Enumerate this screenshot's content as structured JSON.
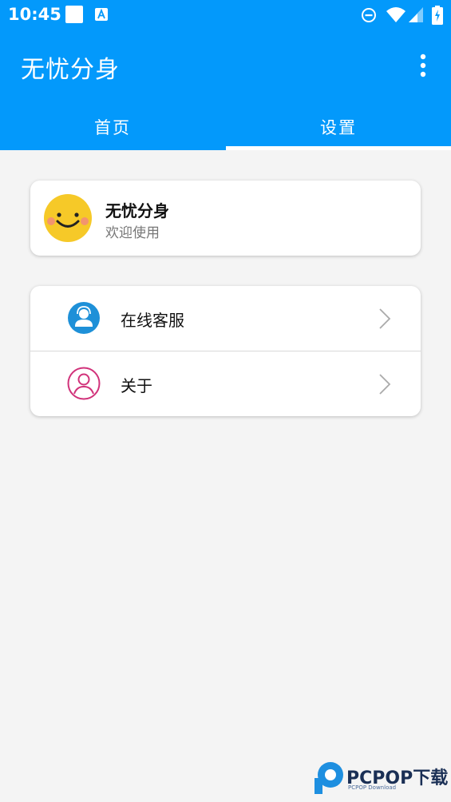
{
  "status_bar": {
    "time": "10:45"
  },
  "appbar": {
    "title": "无忧分身"
  },
  "tabs": [
    {
      "label": "首页",
      "selected": false
    },
    {
      "label": "设置",
      "selected": true
    }
  ],
  "profile": {
    "name": "无忧分身",
    "subtitle": "欢迎使用"
  },
  "menu": [
    {
      "label": "在线客服",
      "icon": "customer-service-icon"
    },
    {
      "label": "关于",
      "icon": "user-outline-icon"
    }
  ],
  "watermark": {
    "brand": "PCPOP下载",
    "sub": "PCPOP Download"
  },
  "colors": {
    "primary": "#0399fb",
    "avatar_yellow": "#f6c928",
    "about_pink": "#d1327a"
  }
}
